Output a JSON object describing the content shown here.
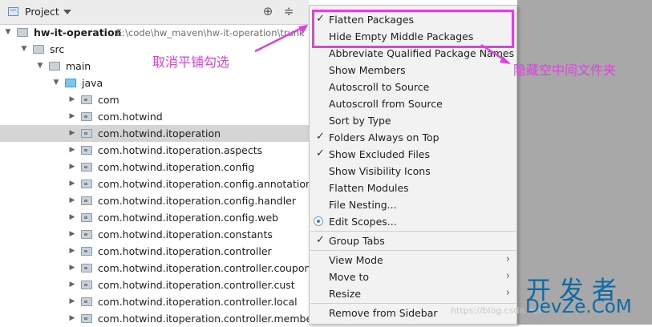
{
  "panel": {
    "title": "Project"
  },
  "tree": [
    {
      "label": "hw-it-operation",
      "path": "E:\\code\\hw_maven\\hw-it-operation\\trunk",
      "expanded": true,
      "bold": true,
      "icon": "module-folder-icon"
    },
    {
      "label": "src",
      "expanded": true,
      "icon": "folder-icon"
    },
    {
      "label": "main",
      "expanded": true,
      "icon": "folder-icon"
    },
    {
      "label": "java",
      "expanded": true,
      "icon": "source-root-folder-icon"
    },
    {
      "label": "com",
      "expanded": false,
      "icon": "package-icon"
    },
    {
      "label": "com.hotwind",
      "expanded": false,
      "icon": "package-icon"
    },
    {
      "label": "com.hotwind.itoperation",
      "expanded": false,
      "icon": "package-icon",
      "selected": true
    },
    {
      "label": "com.hotwind.itoperation.aspects",
      "expanded": false,
      "icon": "package-icon"
    },
    {
      "label": "com.hotwind.itoperation.config",
      "expanded": false,
      "icon": "package-icon"
    },
    {
      "label": "com.hotwind.itoperation.config.annotation",
      "expanded": false,
      "icon": "package-icon"
    },
    {
      "label": "com.hotwind.itoperation.config.handler",
      "expanded": false,
      "icon": "package-icon"
    },
    {
      "label": "com.hotwind.itoperation.config.web",
      "expanded": false,
      "icon": "package-icon"
    },
    {
      "label": "com.hotwind.itoperation.constants",
      "expanded": false,
      "icon": "package-icon"
    },
    {
      "label": "com.hotwind.itoperation.controller",
      "expanded": false,
      "icon": "package-icon"
    },
    {
      "label": "com.hotwind.itoperation.controller.coupon",
      "expanded": false,
      "icon": "package-icon"
    },
    {
      "label": "com.hotwind.itoperation.controller.cust",
      "expanded": false,
      "icon": "package-icon"
    },
    {
      "label": "com.hotwind.itoperation.controller.local",
      "expanded": false,
      "icon": "package-icon"
    },
    {
      "label": "com.hotwind.itoperation.controller.member",
      "expanded": false,
      "icon": "package-icon"
    }
  ],
  "menu": {
    "items": [
      {
        "label": "Flatten Packages",
        "checked": true
      },
      {
        "label": "Hide Empty Middle Packages",
        "checked": false
      },
      {
        "label": "Abbreviate Qualified Package Names",
        "checked": false
      },
      {
        "label": "Show Members",
        "checked": false
      },
      {
        "label": "Autoscroll to Source",
        "checked": false
      },
      {
        "label": "Autoscroll from Source",
        "checked": false
      },
      {
        "label": "Sort by Type",
        "checked": false
      },
      {
        "label": "Folders Always on Top",
        "checked": true
      },
      {
        "label": "Show Excluded Files",
        "checked": true
      },
      {
        "label": "Show Visibility Icons",
        "checked": false
      },
      {
        "label": "Flatten Modules",
        "checked": false
      },
      {
        "label": "File Nesting...",
        "checked": false
      },
      {
        "label": "Edit Scopes...",
        "radio": true
      },
      {
        "label": "Group Tabs",
        "checked": true
      },
      {
        "label": "View Mode",
        "submenu": true
      },
      {
        "label": "Move to",
        "submenu": true
      },
      {
        "label": "Resize",
        "submenu": true
      },
      {
        "label": "Remove from Sidebar"
      }
    ]
  },
  "annotations": {
    "uncheck_flatten": "取消平铺勾选",
    "hide_middle": "隐藏空中间文件夹"
  },
  "watermark": {
    "url": "https://blog.csdn.net",
    "logo_cn": "开发者",
    "logo_en": "DevZe.CoM"
  },
  "colors": {
    "annotation": "#e040e0",
    "selection": "#d5d5d5",
    "menu_bg": "#f2f2f2",
    "logo": "#0c6aa8"
  }
}
